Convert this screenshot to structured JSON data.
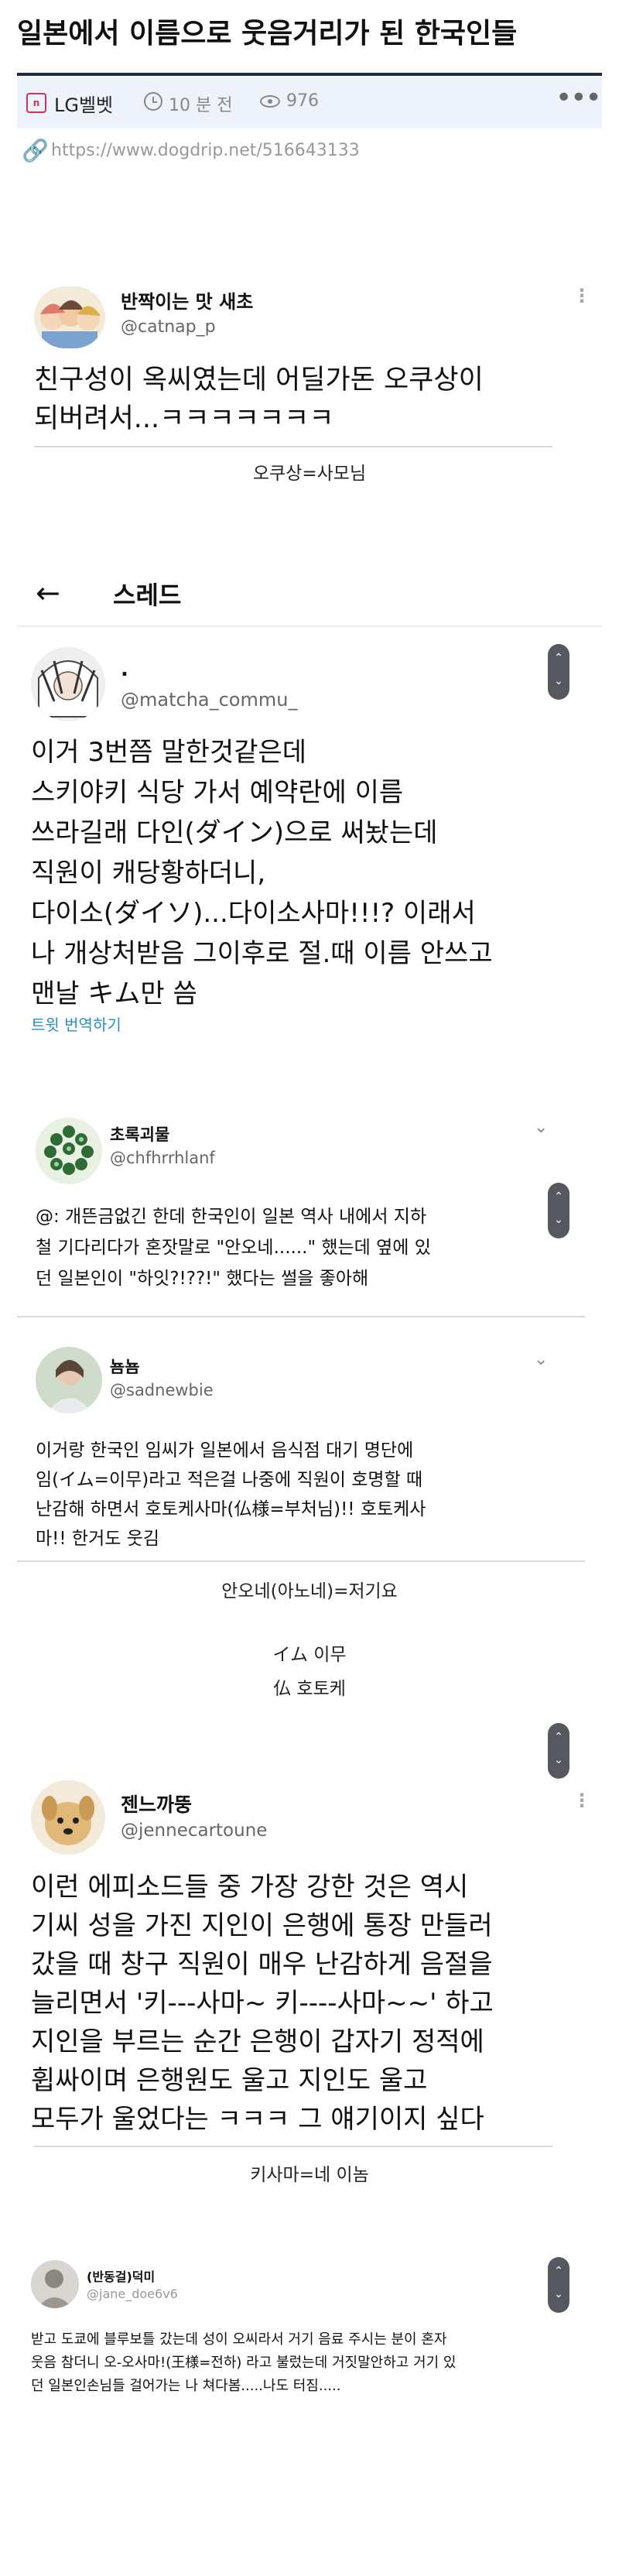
{
  "post": {
    "title": "일본에서 이름으로 웃음거리가 된 한국인들",
    "board": "LG벨벳",
    "time": "10 분 전",
    "views": "976",
    "url": "https://www.dogdrip.net/516643133"
  },
  "tweet1": {
    "name": "반짝이는 맛 새초",
    "handle": "@catnap_p",
    "lines": [
      "친구성이 옥씨였는데 어딜가돈 오쿠상이",
      "되버려서...ㅋㅋㅋㅋㅋㅋㅋ"
    ],
    "caption": "오쿠상=사모님"
  },
  "thread_header": {
    "title": "스레드"
  },
  "tweet2": {
    "name": ".",
    "handle": "@matcha_commu_",
    "lines": [
      "이거 3번쯤 말한것같은데",
      "스키야키 식당 가서 예약란에 이름",
      "쓰라길래 다인(ダイン)으로 써놨는데",
      "직원이 캐당황하더니,",
      "다이소(ダイソ)...다이소사마!!!? 이래서",
      "나 개상처받음 그이후로 절.때 이름 안쓰고",
      "맨날 キム만 씀"
    ],
    "translate": "트윗 번역하기"
  },
  "tweet3": {
    "name": "초록괴물",
    "handle": "@chfhrrhlanf",
    "lines": [
      "@: 개뜬금없긴 한데 한국인이 일본 역사 내에서 지하",
      "철 기다리다가 혼잣말로 \"안오네......\" 했는데 옆에 있",
      "던 일본인이 \"하잇?!??!\" 했다는 썰을 좋아해"
    ]
  },
  "tweet4": {
    "name": "뇸뇸",
    "handle": "@sadnewbie",
    "lines": [
      "이거랑 한국인 임씨가 일본에서 음식점 대기 명단에",
      "임(イム=이무)라고 적은걸 나중에 직원이 호명할 때",
      "난감해 하면서 호토케사마(仏様=부처님)!! 호토케사",
      "마!! 한거도 웃김"
    ],
    "captions": [
      "안오네(아노네)=저기요",
      "イム 이무",
      "仏 호토케"
    ]
  },
  "tweet5": {
    "name": "젠느까뚱",
    "handle": "@jennecartoune",
    "lines": [
      "이런 에피소드들 중 가장 강한 것은 역시",
      "기씨 성을 가진 지인이 은행에 통장 만들러",
      "갔을 때 창구 직원이 매우 난감하게 음절을",
      "늘리면서 '키---사마~ 키----사마~~' 하고",
      "지인을 부르는 순간 은행이 갑자기 정적에",
      "휩싸이며 은행원도 울고 지인도 울고",
      "모두가 울었다는 ㅋㅋㅋ 그 얘기이지 싶다"
    ],
    "caption": "키사마=네 이놈"
  },
  "tweet6": {
    "name": "(반동걸)덕미",
    "handle": "@jane_doe6v6",
    "lines": [
      "받고 도쿄에 블루보틀 갔는데 성이 오씨라서 거기 음료 주시는 분이 혼자",
      "웃음 참더니 오-오사마!(王様=전하) 라고 불렀는데 거짓말안하고 거기 있",
      "던 일본인손님들 걸어가는 나 쳐다봄.....나도 터짐....."
    ]
  },
  "icons": {
    "back": "arrow-left-icon",
    "more": "more-horizontal-icon",
    "kebab": "more-vertical-icon",
    "chevron": "chevron-down-icon",
    "link": "link-icon",
    "clock": "clock-icon",
    "eye": "eye-icon"
  },
  "colors": {
    "title_rule": "#1d2b49",
    "meta_bg": "#eef2fa",
    "board_icon": "#d2325a",
    "translate_link": "#2a8fbf"
  }
}
